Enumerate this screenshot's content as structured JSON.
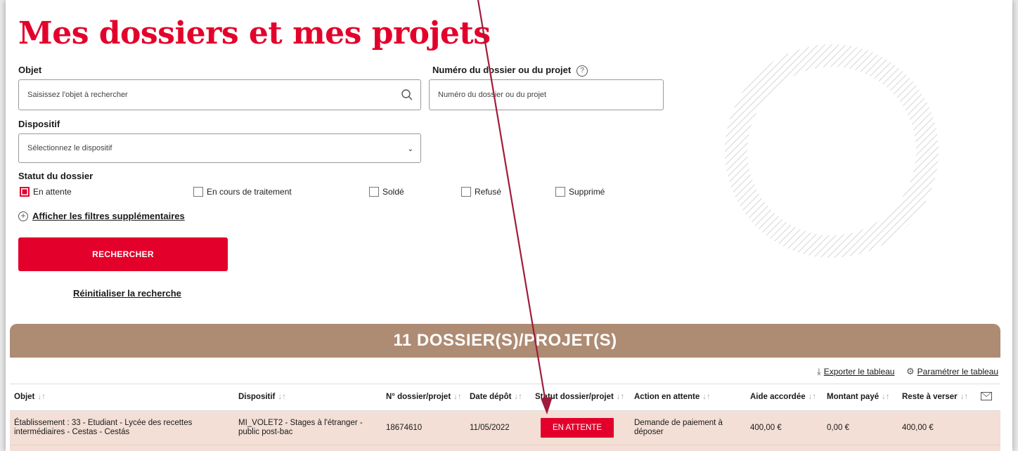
{
  "page": {
    "title": "Mes dossiers et mes projets"
  },
  "filters": {
    "objet": {
      "label": "Objet",
      "placeholder": "Saisissez l'objet à rechercher"
    },
    "numero": {
      "label": "Numéro du dossier ou du projet",
      "help": "?",
      "placeholder": "Numéro du dossier ou du projet"
    },
    "dispositif": {
      "label": "Dispositif",
      "selected": "Sélectionnez le dispositif"
    },
    "statut": {
      "label": "Statut du dossier",
      "options": [
        {
          "label": "En attente",
          "checked": true
        },
        {
          "label": "En cours de traitement",
          "checked": false
        },
        {
          "label": "Soldé",
          "checked": false
        },
        {
          "label": "Refusé",
          "checked": false
        },
        {
          "label": "Supprimé",
          "checked": false
        }
      ]
    },
    "more_filters": "Afficher les filtres supplémentaires",
    "search_button": "RECHERCHER",
    "reset_link": "Réinitialiser la recherche"
  },
  "results": {
    "heading": "11 DOSSIER(S)/PROJET(S)",
    "export_label": "Exporter le tableau",
    "settings_label": "Paramétrer le tableau",
    "sort_glyph": "↓↑",
    "columns": [
      "Objet",
      "Dispositif",
      "N° dossier/projet",
      "Date dépôt",
      "Statut dossier/projet",
      "Action en attente",
      "Aide accordée",
      "Montant payé",
      "Reste à verser"
    ],
    "rows": [
      {
        "objet_line1": "Établissement : 33 - Etudiant - Lycée des recettes",
        "objet_line2": "intermédiaires - Cestas - Cestás",
        "dispositif_line1": "MI_VOLET2 - Stages à l'étranger -",
        "dispositif_line2": "public post-bac",
        "numero": "18674610",
        "date": "11/05/2022",
        "statut": "EN ATTENTE",
        "action_line1": "Demande de paiement à",
        "action_line2": "déposer",
        "aide": "400,00 €",
        "paye": "0,00 €",
        "reste": "400,00 €"
      }
    ]
  },
  "colors": {
    "brand_red": "#e3002b",
    "header_brown": "#ae8b73",
    "row_bg": "#f3dfd6",
    "arrow": "#a01c3c"
  },
  "icons": [
    "search-icon",
    "help-icon",
    "chevron-down-icon",
    "plus-circle-icon",
    "export-icon",
    "settings-icon",
    "mail-icon",
    "sort-icon"
  ]
}
